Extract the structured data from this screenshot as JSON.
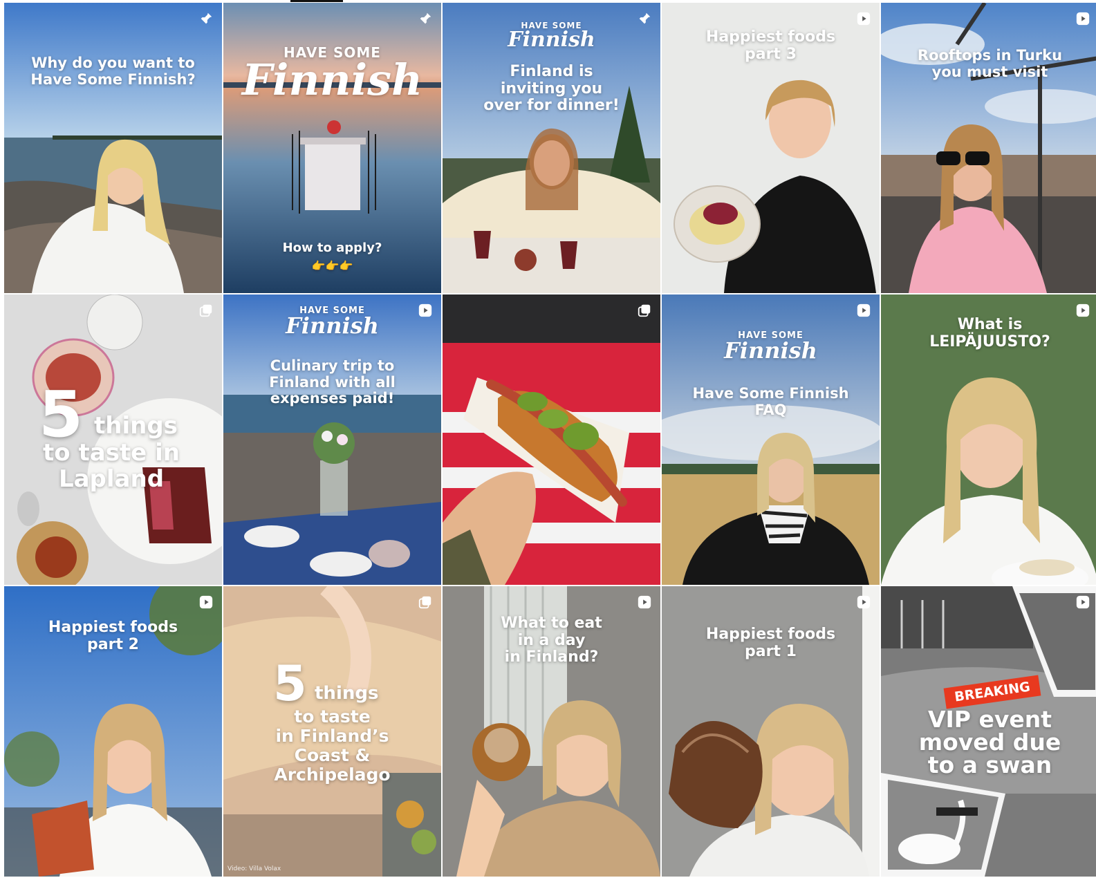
{
  "grid": {
    "tiles": [
      {
        "badge": "pin-icon",
        "caption": "Why do you want to\nHave Some Finnish?"
      },
      {
        "badge": "pin-icon",
        "brand_small": "HAVE SOME",
        "brand_big": "Finnish",
        "caption": "How to apply?",
        "emoji": "👉👉👉"
      },
      {
        "badge": "pin-icon",
        "brand_small": "HAVE SOME",
        "brand_big": "Finnish",
        "caption": "Finland is\ninviting you\nover for dinner!"
      },
      {
        "badge": "reel-icon",
        "caption": "Happiest foods\npart 3"
      },
      {
        "badge": "reel-icon",
        "caption": "Rooftops in Turku\nyou must visit"
      },
      {
        "badge": "carousel-icon",
        "big_number": "5",
        "caption_a": "things",
        "caption_b": "to taste in\nLapland"
      },
      {
        "badge": "reel-icon",
        "brand_small": "HAVE SOME",
        "brand_big": "Finnish",
        "caption": "Culinary trip to\nFinland with all\nexpenses paid!"
      },
      {
        "badge": "carousel-icon"
      },
      {
        "badge": "reel-icon",
        "brand_small": "HAVE SOME",
        "brand_big": "Finnish",
        "caption": "Have Some Finnish\nFAQ"
      },
      {
        "badge": "reel-icon",
        "caption": "What is\nLEIPÄJUUSTO?"
      },
      {
        "badge": "reel-icon",
        "caption": "Happiest foods\npart 2"
      },
      {
        "badge": "carousel-icon",
        "big_number": "5",
        "caption_a": "things",
        "caption_b": "to taste\nin Finland’s\nCoast &\nArchipelago",
        "credit": "Video: Villa Volax"
      },
      {
        "badge": "reel-icon",
        "caption": "What to eat\nin a day\nin Finland?"
      },
      {
        "badge": "reel-icon",
        "caption": "Happiest foods\npart 1"
      },
      {
        "badge": "reel-icon",
        "breaking": "BREAKING",
        "caption": "VIP event\nmoved due\nto a swan"
      }
    ]
  }
}
